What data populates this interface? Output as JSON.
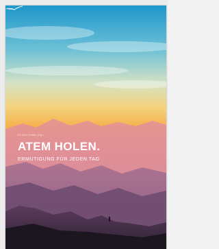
{
  "book": {
    "editor": "Eli Dom Politis (Hg.)",
    "title": "ATEM HOLEN.",
    "subtitle": "ERMUTIGUNG FÜR JEDEN TAG"
  },
  "colors": {
    "sky_top": "#2ea3d2",
    "sky_mid": "#e9e0b8",
    "sky_warm": "#f3b24d",
    "horizon": "#f08a6a",
    "mountains_far": "#c98aa6",
    "mountains_mid": "#8a5f86",
    "mountains_near": "#3d2a3f",
    "foreground": "#1c1620"
  },
  "icons": {
    "publisher_logo": "bird-logo-icon",
    "hiker": "hiker-silhouette-icon"
  }
}
